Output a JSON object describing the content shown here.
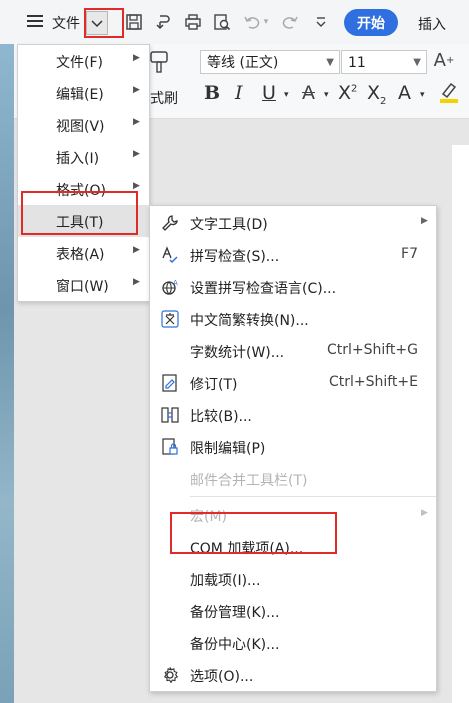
{
  "toolbar": {
    "file_label": "文件",
    "start_label": "开始",
    "insert_label": "插入"
  },
  "ribbon": {
    "font_name": "等线 (正文)",
    "font_size": "11",
    "format_painter_label": "式刷"
  },
  "main_menu": {
    "items": [
      {
        "label": "文件(F)"
      },
      {
        "label": "编辑(E)"
      },
      {
        "label": "视图(V)"
      },
      {
        "label": "插入(I)"
      },
      {
        "label": "格式(O)"
      },
      {
        "label": "工具(T)"
      },
      {
        "label": "表格(A)"
      },
      {
        "label": "窗口(W)"
      }
    ]
  },
  "tools_menu": {
    "items": [
      {
        "label": "文字工具(D)",
        "shortcut": ""
      },
      {
        "label": "拼写检查(S)...",
        "shortcut": "F7"
      },
      {
        "label": "设置拼写检查语言(C)...",
        "shortcut": ""
      },
      {
        "label": "中文简繁转换(N)...",
        "shortcut": ""
      },
      {
        "label": "字数统计(W)...",
        "shortcut": "Ctrl+Shift+G"
      },
      {
        "label": "修订(T)",
        "shortcut": "Ctrl+Shift+E"
      },
      {
        "label": "比较(B)...",
        "shortcut": ""
      },
      {
        "label": "限制编辑(P)",
        "shortcut": ""
      },
      {
        "label": "邮件合并工具栏(T)",
        "shortcut": ""
      },
      {
        "label": "宏(M)",
        "shortcut": ""
      },
      {
        "label": "COM 加载项(A)...",
        "shortcut": ""
      },
      {
        "label": "加载项(I)...",
        "shortcut": ""
      },
      {
        "label": "备份管理(K)...",
        "shortcut": ""
      },
      {
        "label": "备份中心(K)...",
        "shortcut": ""
      },
      {
        "label": "选项(O)...",
        "shortcut": ""
      }
    ]
  },
  "colors": {
    "accent": "#2f6fdf",
    "highlight_box": "#e12a2a"
  }
}
